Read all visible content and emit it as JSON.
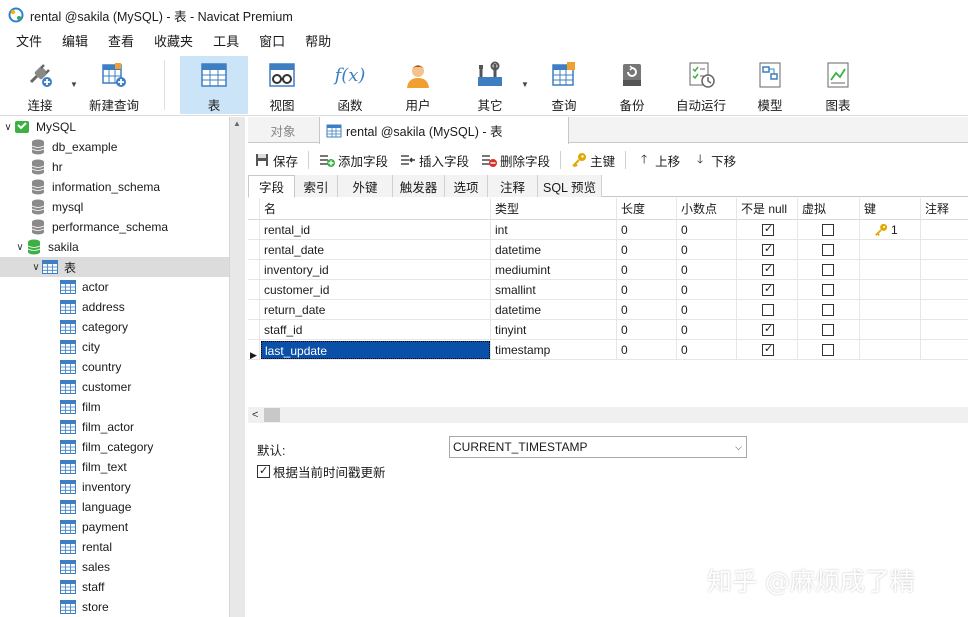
{
  "window": {
    "title": "rental @sakila (MySQL) - 表 - Navicat Premium"
  },
  "menu": [
    "文件",
    "编辑",
    "查看",
    "收藏夹",
    "工具",
    "窗口",
    "帮助"
  ],
  "toolbar": {
    "connect": "连接",
    "new_query": "新建查询",
    "table": "表",
    "view": "视图",
    "function": "函数",
    "user": "用户",
    "other": "其它",
    "query": "查询",
    "backup": "备份",
    "automation": "自动运行",
    "model": "模型",
    "chart": "图表",
    "function_glyph": "f(x)"
  },
  "nav": {
    "root": "MySQL",
    "databases": [
      "db_example",
      "hr",
      "information_schema",
      "mysql",
      "performance_schema"
    ],
    "open_db": "sakila",
    "tables_node": "表",
    "tables": [
      "actor",
      "address",
      "category",
      "city",
      "country",
      "customer",
      "film",
      "film_actor",
      "film_category",
      "film_text",
      "inventory",
      "language",
      "payment",
      "rental",
      "sales",
      "staff",
      "store"
    ]
  },
  "tabs": {
    "objects": "对象",
    "doc": "rental @sakila (MySQL) - 表"
  },
  "design_toolbar": {
    "save": "保存",
    "add_field": "添加字段",
    "insert_field": "插入字段",
    "delete_field": "删除字段",
    "primary_key": "主键",
    "move_up": "上移",
    "move_down": "下移"
  },
  "subtabs": [
    "字段",
    "索引",
    "外键",
    "触发器",
    "选项",
    "注释",
    "SQL 预览"
  ],
  "grid": {
    "headers": {
      "name": "名",
      "type": "类型",
      "length": "长度",
      "decimals": "小数点",
      "not_null": "不是 null",
      "virtual": "虚拟",
      "key": "键",
      "comment": "注释"
    },
    "rows": [
      {
        "name": "rental_id",
        "type": "int",
        "length": "0",
        "decimals": "0",
        "not_null": true,
        "virtual": false,
        "key": "1"
      },
      {
        "name": "rental_date",
        "type": "datetime",
        "length": "0",
        "decimals": "0",
        "not_null": true,
        "virtual": false,
        "key": ""
      },
      {
        "name": "inventory_id",
        "type": "mediumint",
        "length": "0",
        "decimals": "0",
        "not_null": true,
        "virtual": false,
        "key": ""
      },
      {
        "name": "customer_id",
        "type": "smallint",
        "length": "0",
        "decimals": "0",
        "not_null": true,
        "virtual": false,
        "key": ""
      },
      {
        "name": "return_date",
        "type": "datetime",
        "length": "0",
        "decimals": "0",
        "not_null": false,
        "virtual": false,
        "key": ""
      },
      {
        "name": "staff_id",
        "type": "tinyint",
        "length": "0",
        "decimals": "0",
        "not_null": true,
        "virtual": false,
        "key": ""
      },
      {
        "name": "last_update",
        "type": "timestamp",
        "length": "0",
        "decimals": "0",
        "not_null": true,
        "virtual": false,
        "key": ""
      }
    ]
  },
  "props": {
    "default_label": "默认:",
    "default_value": "CURRENT_TIMESTAMP",
    "on_update_label": "根据当前时间戳更新",
    "on_update_checked": true
  },
  "watermark": "知乎 @麻烦成了精",
  "colors": {
    "selection": "#0a4fa8",
    "toolbar_active": "#cce4f7",
    "db_green": "#3cb043",
    "table_blue": "#3d7fc2"
  }
}
